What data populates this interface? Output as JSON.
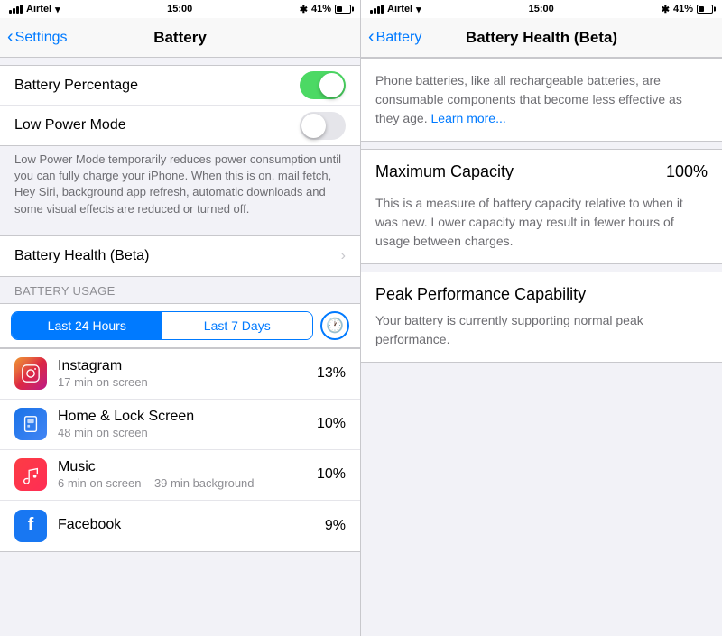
{
  "left": {
    "statusBar": {
      "carrier": "Airtel",
      "time": "15:00",
      "bluetooth": "✱",
      "battery_pct": "41%"
    },
    "navBar": {
      "back_label": "Settings",
      "title": "Battery"
    },
    "rows": [
      {
        "id": "battery-percentage",
        "label": "Battery Percentage",
        "toggle": "on"
      },
      {
        "id": "low-power-mode",
        "label": "Low Power Mode",
        "toggle": "off"
      }
    ],
    "infoText": "Low Power Mode temporarily reduces power consumption until you can fully charge your iPhone. When this is on, mail fetch, Hey Siri, background app refresh, automatic downloads and some visual effects are reduced or turned off.",
    "healthRow": {
      "label": "Battery Health (Beta)"
    },
    "usageHeader": "BATTERY USAGE",
    "tabs": {
      "active": "Last 24 Hours",
      "inactive": "Last 7 Days"
    },
    "apps": [
      {
        "id": "instagram",
        "name": "Instagram",
        "time": "17 min on screen",
        "percent": "13%",
        "icon": "instagram",
        "emoji": "📷"
      },
      {
        "id": "homescreen",
        "name": "Home & Lock Screen",
        "time": "48 min on screen",
        "percent": "10%",
        "icon": "homescreen",
        "emoji": "📱"
      },
      {
        "id": "music",
        "name": "Music",
        "time": "6 min on screen – 39 min background",
        "percent": "10%",
        "icon": "music",
        "emoji": "♪"
      },
      {
        "id": "facebook",
        "name": "Facebook",
        "time": "",
        "percent": "9%",
        "icon": "facebook",
        "emoji": "f"
      }
    ]
  },
  "right": {
    "statusBar": {
      "carrier": "Airtel",
      "time": "15:00",
      "bluetooth": "✱",
      "battery_pct": "41%"
    },
    "navBar": {
      "back_label": "Battery",
      "title": "Battery Health (Beta)"
    },
    "intro": "Phone batteries, like all rechargeable batteries, are consumable components that become less effective as they age.",
    "learnMore": "Learn more...",
    "maxCapacity": {
      "label": "Maximum Capacity",
      "value": "100%",
      "description": "This is a measure of battery capacity relative to when it was new. Lower capacity may result in fewer hours of usage between charges."
    },
    "peakPerformance": {
      "label": "Peak Performance Capability",
      "description": "Your battery is currently supporting normal peak performance."
    }
  }
}
